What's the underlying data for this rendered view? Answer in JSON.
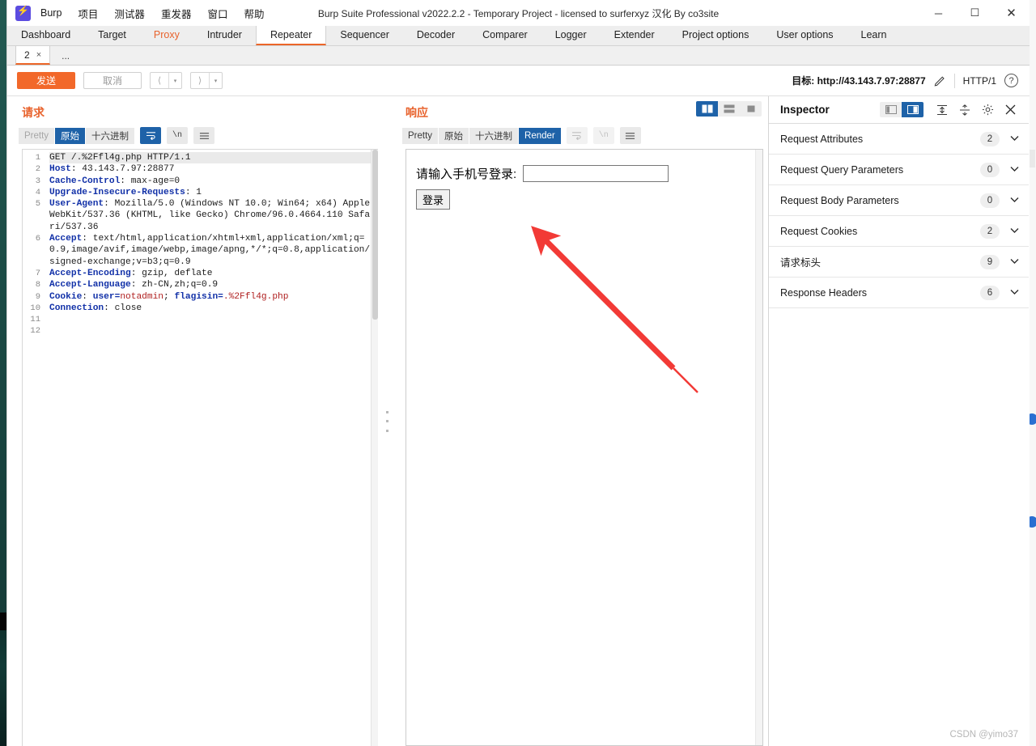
{
  "window": {
    "title": "Burp Suite Professional v2022.2.2 - Temporary Project - licensed to surferxyz 汉化 By co3site",
    "logo_icon": "burp-lightning-icon",
    "controls": {
      "minimize": "─",
      "maximize": "☐",
      "close": "✕"
    }
  },
  "menu": [
    {
      "label": "Burp"
    },
    {
      "label": "项目"
    },
    {
      "label": "测试器"
    },
    {
      "label": "重发器"
    },
    {
      "label": "窗口"
    },
    {
      "label": "帮助"
    }
  ],
  "main_tabs": [
    {
      "label": "Dashboard",
      "active": false
    },
    {
      "label": "Target",
      "active": false
    },
    {
      "label": "Proxy",
      "active": false
    },
    {
      "label": "Intruder",
      "active": false
    },
    {
      "label": "Repeater",
      "active": true
    },
    {
      "label": "Sequencer",
      "active": false
    },
    {
      "label": "Decoder",
      "active": false
    },
    {
      "label": "Comparer",
      "active": false
    },
    {
      "label": "Logger",
      "active": false
    },
    {
      "label": "Extender",
      "active": false
    },
    {
      "label": "Project options",
      "active": false
    },
    {
      "label": "User options",
      "active": false
    },
    {
      "label": "Learn",
      "active": false
    }
  ],
  "repeater_tabs": {
    "open_tab_label": "2",
    "close_glyph": "×",
    "add_tab_label": "..."
  },
  "action_bar": {
    "send_label": "发送",
    "cancel_label": "取消",
    "back_glyph": "⟨",
    "forward_glyph": "⟩",
    "dropdown_glyph": "▾",
    "target_label": "目标: http://43.143.7.97:28877",
    "edit_icon": "pencil-icon",
    "http_version": "HTTP/1",
    "help_icon": "question-mark-icon"
  },
  "request": {
    "title": "请求",
    "view_buttons": [
      {
        "label": "Pretty",
        "state": "muted"
      },
      {
        "label": "原始",
        "state": "active"
      },
      {
        "label": "十六进制",
        "state": "normal"
      }
    ],
    "wrap_icon": "word-wrap-icon",
    "newline_icon": "newline-icon",
    "menu_icon": "hamburger-menu-icon",
    "lines": [
      {
        "n": "1",
        "highlight": true,
        "parts": [
          {
            "t": "GET /.%2Ffl4g.php HTTP/1.1",
            "k": "plain"
          }
        ]
      },
      {
        "n": "2",
        "parts": [
          {
            "t": "Host",
            "k": "hdr"
          },
          {
            "t": ": 43.143.7.97:28877",
            "k": "plain"
          }
        ]
      },
      {
        "n": "3",
        "parts": [
          {
            "t": "Cache-Control",
            "k": "hdr"
          },
          {
            "t": ": max-age=0",
            "k": "plain"
          }
        ]
      },
      {
        "n": "4",
        "parts": [
          {
            "t": "Upgrade-Insecure-Requests",
            "k": "hdr"
          },
          {
            "t": ": 1",
            "k": "plain"
          }
        ]
      },
      {
        "n": "5",
        "parts": [
          {
            "t": "User-Agent",
            "k": "hdr"
          },
          {
            "t": ": Mozilla/5.0 (Windows NT 10.0; Win64; x64) AppleWebKit/537.36 (KHTML, like Gecko) Chrome/96.0.4664.110 Safari/537.36",
            "k": "plain"
          }
        ]
      },
      {
        "n": "6",
        "parts": [
          {
            "t": "Accept",
            "k": "hdr"
          },
          {
            "t": ": text/html,application/xhtml+xml,application/xml;q=0.9,image/avif,image/webp,image/apng,*/*;q=0.8,application/signed-exchange;v=b3;q=0.9",
            "k": "plain"
          }
        ]
      },
      {
        "n": "7",
        "parts": [
          {
            "t": "Accept-Encoding",
            "k": "hdr"
          },
          {
            "t": ": gzip, deflate",
            "k": "plain"
          }
        ]
      },
      {
        "n": "8",
        "parts": [
          {
            "t": "Accept-Language",
            "k": "hdr"
          },
          {
            "t": ": zh-CN,zh;q=0.9",
            "k": "plain"
          }
        ]
      },
      {
        "n": "9",
        "parts": [
          {
            "t": "Cookie",
            "k": "hdr"
          },
          {
            "t": ": ",
            "k": "plain"
          },
          {
            "t": "user=",
            "k": "hdr"
          },
          {
            "t": "notadmin",
            "k": "red"
          },
          {
            "t": "; ",
            "k": "plain"
          },
          {
            "t": "flagisin=",
            "k": "hdr"
          },
          {
            "t": ".%2Ffl4g.php",
            "k": "red"
          }
        ]
      },
      {
        "n": "10",
        "parts": [
          {
            "t": "Connection",
            "k": "hdr"
          },
          {
            "t": ": close",
            "k": "plain"
          }
        ]
      },
      {
        "n": "11",
        "parts": []
      },
      {
        "n": "12",
        "parts": []
      }
    ]
  },
  "response": {
    "title": "响应",
    "view_buttons": [
      {
        "label": "Pretty",
        "state": "normal"
      },
      {
        "label": "原始",
        "state": "normal"
      },
      {
        "label": "十六进制",
        "state": "normal"
      },
      {
        "label": "Render",
        "state": "active"
      }
    ],
    "wrap_icon": "word-wrap-icon",
    "newline_icon": "newline-icon",
    "menu_icon": "hamburger-menu-icon",
    "layout_buttons": [
      {
        "icon": "split-vertical-icon",
        "active": true
      },
      {
        "icon": "split-horizontal-icon",
        "active": false
      },
      {
        "icon": "single-pane-icon",
        "active": false
      }
    ],
    "rendered_page": {
      "prompt": "请输入手机号登录:",
      "input_value": "",
      "input_placeholder": "",
      "submit_label": "登录"
    },
    "annotation": {
      "type": "red-arrow",
      "color": "#f23a36"
    }
  },
  "inspector": {
    "title": "Inspector",
    "layout_buttons": [
      {
        "icon": "panel-left-icon",
        "active": false
      },
      {
        "icon": "panel-right-icon",
        "active": true
      }
    ],
    "expand_all_icon": "expand-all-icon",
    "collapse_all_icon": "collapse-all-icon",
    "settings_icon": "gear-icon",
    "close_icon": "close-icon",
    "sections": [
      {
        "label": "Request Attributes",
        "count": "2"
      },
      {
        "label": "Request Query Parameters",
        "count": "0"
      },
      {
        "label": "Request Body Parameters",
        "count": "0"
      },
      {
        "label": "Request Cookies",
        "count": "2"
      },
      {
        "label": "请求标头",
        "count": "9"
      },
      {
        "label": "Response Headers",
        "count": "6"
      }
    ]
  },
  "watermark": "CSDN @yimo37",
  "colors": {
    "accent_orange": "#ec6629",
    "send_orange": "#f2682a",
    "active_blue": "#1e62a8",
    "arrow_red": "#f23a36"
  }
}
